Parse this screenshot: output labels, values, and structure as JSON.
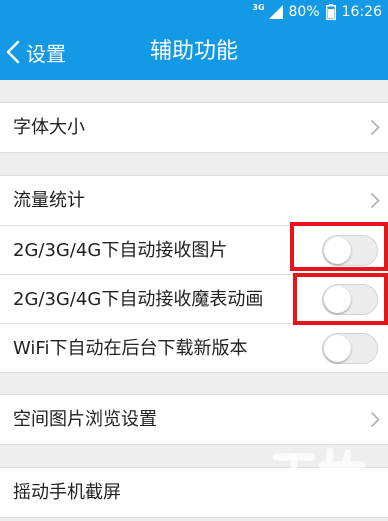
{
  "status_bar": {
    "network": "3G",
    "battery": "80%",
    "time": "16:26"
  },
  "nav": {
    "back_label": "设置",
    "title": "辅助功能"
  },
  "sections": [
    {
      "items": [
        {
          "label": "字体大小",
          "control": "chevron"
        }
      ]
    },
    {
      "items": [
        {
          "label": "流量统计",
          "control": "chevron"
        },
        {
          "label": "2G/3G/4G下自动接收图片",
          "control": "toggle",
          "on": false
        },
        {
          "label": "2G/3G/4G下自动接收魔表动画",
          "control": "toggle",
          "on": false
        },
        {
          "label": "WiFi下自动在后台下载新版本",
          "control": "toggle",
          "on": false
        }
      ]
    },
    {
      "items": [
        {
          "label": "空间图片浏览设置",
          "control": "chevron"
        }
      ]
    },
    {
      "items": [
        {
          "label": "摇动手机截屏",
          "control": "none"
        }
      ]
    }
  ],
  "colors": {
    "accent": "#1499e6",
    "highlight": "#e8141b"
  }
}
